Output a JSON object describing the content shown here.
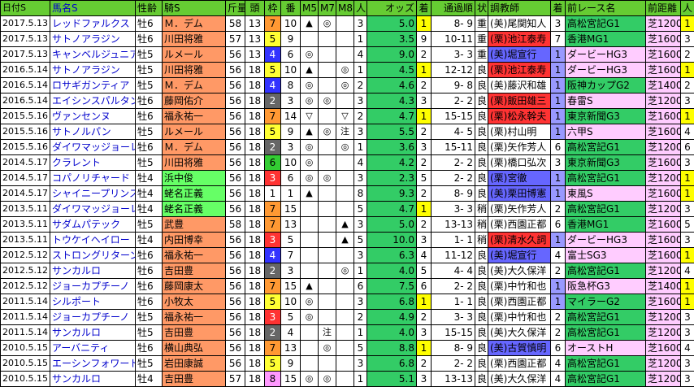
{
  "headers": [
    "日付S",
    "馬名S",
    "性齢",
    "騎S",
    "斤量",
    "頭",
    "枠",
    "番",
    "M5",
    "M7",
    "M8",
    "人",
    "オッズ",
    "着",
    "通過順",
    "状",
    "調教師",
    "着",
    "前レース名",
    "前距離",
    "人"
  ],
  "rows": [
    [
      "2017.5.13",
      "レッドファルクス",
      "牡6",
      "Ｍ．デム",
      "58",
      "13",
      "7",
      "10",
      "▲",
      "◎",
      "",
      "3",
      "5.0",
      "1",
      "8- 9",
      "重",
      "(美)尾関知人",
      "3",
      "高松宮記G1",
      "芝1200",
      "1"
    ],
    [
      "2017.5.13",
      "サトノアラジン",
      "牡6",
      "川田将雅",
      "57",
      "13",
      "5",
      "9",
      "",
      "",
      "",
      "1",
      "3.5",
      "9",
      "10-11",
      "重",
      "(栗)池江泰寿",
      "7",
      "香港MG1",
      "芝1600",
      "3"
    ],
    [
      "2017.5.13",
      "キャンベルジュニア",
      "牡5",
      "ルメール",
      "56",
      "13",
      "4",
      "6",
      "◎",
      "",
      "",
      "4",
      "9.0",
      "2",
      "3- 3",
      "重",
      "(美)堀宣行",
      "1",
      "ダービーHG3",
      "芝1600",
      "2"
    ],
    [
      "2016.5.14",
      "サトノアラジン",
      "牡5",
      "川田将雅",
      "56",
      "18",
      "5",
      "10",
      "▲",
      "",
      "◎",
      "1",
      "4.5",
      "1",
      "12-12",
      "良",
      "(栗)池江泰寿",
      "1",
      "ダービーHG3",
      "芝1600",
      "1"
    ],
    [
      "2016.5.14",
      "ロサギガンティア",
      "牡5",
      "Ｍ．デム",
      "56",
      "18",
      "4",
      "8",
      "◎",
      "",
      "◎",
      "2",
      "4.6",
      "2",
      "9- 8",
      "良",
      "(美)藤沢和雄",
      "1",
      "阪神カップG2",
      "芝1400",
      "2"
    ],
    [
      "2016.5.14",
      "エイシンスパルタン",
      "牡6",
      "藤岡佑介",
      "56",
      "18",
      "2",
      "3",
      "◎",
      "◎",
      "",
      "3",
      "4.3",
      "3",
      "2- 2",
      "良",
      "(栗)飯田雄三",
      "1",
      "春雷S",
      "芝1200",
      "3"
    ],
    [
      "2015.5.16",
      "ヴァンセンヌ",
      "牡6",
      "福永祐一",
      "56",
      "18",
      "7",
      "14",
      "▽",
      "",
      "▽",
      "2",
      "4.7",
      "1",
      "15-15",
      "良",
      "(栗)松永幹夫",
      "1",
      "東京新聞G3",
      "芝1600",
      "1"
    ],
    [
      "2015.5.16",
      "サトノルパン",
      "牡5",
      "ルメール",
      "56",
      "18",
      "5",
      "9",
      "▲",
      "◎",
      "注",
      "3",
      "5.5",
      "2",
      "4- 5",
      "良",
      "(栗)村山明",
      "1",
      "六甲S",
      "芝1600",
      "4"
    ],
    [
      "2015.5.16",
      "ダイワマッジョーレ",
      "牡6",
      "Ｍ．デム",
      "56",
      "18",
      "2",
      "3",
      "◎",
      "",
      "◎",
      "1",
      "3.6",
      "3",
      "15-11",
      "良",
      "(栗)矢作芳人",
      "6",
      "高松宮記G1",
      "芝1200",
      "6"
    ],
    [
      "2014.5.17",
      "クラレント",
      "牡5",
      "川田将雅",
      "56",
      "18",
      "6",
      "10",
      "◎",
      "",
      "",
      "4",
      "4.2",
      "2",
      "2- 2",
      "良",
      "(栗)橋口弘次",
      "3",
      "東京新聞G3",
      "芝1600",
      "3"
    ],
    [
      "2014.5.17",
      "コパノリチャード",
      "牡4",
      "浜中俊",
      "56",
      "18",
      "3",
      "6",
      "◎",
      "◎",
      "",
      "3",
      "2.3",
      "5",
      "2- 2",
      "良",
      "(栗)宮徹",
      "1",
      "高松宮記G1",
      "芝1200",
      "1"
    ],
    [
      "2014.5.17",
      "シャイニープリンス",
      "牡4",
      "蛯名正義",
      "56",
      "18",
      "1",
      "1",
      "▲",
      "",
      "",
      "8",
      "9.3",
      "2",
      "8- 9",
      "良",
      "(美)栗田博憲",
      "1",
      "東風S",
      "芝1600",
      "1"
    ],
    [
      "2013.5.11",
      "ダイワマッジョーレ",
      "牡4",
      "蛯名正義",
      "56",
      "18",
      "7",
      "15",
      "",
      "",
      "",
      "5",
      "4.7",
      "1",
      "3- 3",
      "稍",
      "(栗)矢作芳人",
      "2",
      "高松宮記G1",
      "芝1200",
      "3"
    ],
    [
      "2013.5.11",
      "サダムパテック",
      "牡5",
      "武豊",
      "58",
      "18",
      "7",
      "13",
      "",
      "",
      "▲",
      "3",
      "5.0",
      "2",
      "13-13",
      "稍",
      "(栗)西園正都",
      "6",
      "香港MG1",
      "芝1600",
      "5"
    ],
    [
      "2013.5.11",
      "トウケイヘイロー",
      "牡4",
      "内田博幸",
      "56",
      "18",
      "3",
      "5",
      "",
      "",
      "▲",
      "5",
      "10.0",
      "3",
      "1- 1",
      "稍",
      "(栗)清水久詞",
      "1",
      "ダービーHG3",
      "芝1600",
      "3"
    ],
    [
      "2012.5.12",
      "ストロングリターン",
      "牡6",
      "福永祐一",
      "56",
      "18",
      "4",
      "7",
      "",
      "",
      "",
      "3",
      "6.3",
      "4",
      "11-12",
      "良",
      "(美)堀宣行",
      "4",
      "富士SG3",
      "芝1600",
      "1"
    ],
    [
      "2012.5.12",
      "サンカルロ",
      "牡6",
      "吉田豊",
      "56",
      "18",
      "2",
      "3",
      "",
      "",
      "◎",
      "1",
      "4.0",
      "5",
      "4- 4",
      "良",
      "(美)大久保洋",
      "2",
      "高松宮記G1",
      "芝1200",
      "4"
    ],
    [
      "2012.5.12",
      "ジョーカプチーノ",
      "牡6",
      "藤岡康太",
      "56",
      "18",
      "7",
      "15",
      "▲",
      "",
      "",
      "6",
      "7.5",
      "6",
      "2- 2",
      "良",
      "(栗)中竹和也",
      "1",
      "阪急杯G3",
      "芝1400",
      "1"
    ],
    [
      "2011.5.14",
      "シルポート",
      "牡6",
      "小牧太",
      "56",
      "18",
      "5",
      "10",
      "◎",
      "",
      "",
      "3",
      "6.8",
      "1",
      "1- 1",
      "良",
      "(栗)西園正都",
      "1",
      "マイラーG2",
      "芝1600",
      "1"
    ],
    [
      "2011.5.14",
      "ジョーカプチーノ",
      "牡5",
      "福永祐一",
      "56",
      "18",
      "3",
      "5",
      "◎",
      "",
      "",
      "2",
      "4.9",
      "2",
      "3- 3",
      "良",
      "(栗)中竹和也",
      "2",
      "高松宮記G1",
      "芝1200",
      "3"
    ],
    [
      "2011.5.14",
      "サンカルロ",
      "牡5",
      "吉田豊",
      "56",
      "18",
      "2",
      "4",
      "",
      "注",
      "",
      "1",
      "4.0",
      "3",
      "15-15",
      "良",
      "(美)大久保洋",
      "2",
      "高松宮記G1",
      "芝1200",
      "3"
    ],
    [
      "2010.5.15",
      "アーバニティ",
      "牡6",
      "横山典弘",
      "56",
      "18",
      "7",
      "13",
      "",
      "◎",
      "",
      "5",
      "8.8",
      "1",
      "8- 9",
      "良",
      "(美)古賀慎明",
      "6",
      "オーストH",
      "芝1600",
      "4"
    ],
    [
      "2010.5.15",
      "エーシンフォワード",
      "牡5",
      "岩田康誠",
      "56",
      "18",
      "5",
      "9",
      "",
      "",
      "",
      "3",
      "6.8",
      "2",
      "2- 2",
      "良",
      "(栗)西園正都",
      "4",
      "高松宮記G1",
      "芝1200",
      "3"
    ],
    [
      "2010.5.15",
      "サンカルロ",
      "牡4",
      "吉田豊",
      "57",
      "18",
      "8",
      "15",
      "◎",
      "◎",
      "",
      "1",
      "5.1",
      "3",
      "13-13",
      "良",
      "(美)大久保洋",
      "4",
      "高松宮記G1",
      "芝1200",
      "3"
    ]
  ],
  "colors": {
    "header_bg": "#66cc33",
    "jockey_orange": "#ff9966",
    "jockey_green": "#66ff66",
    "waku": [
      "#ffffff",
      "#ffffff",
      "#666666",
      "#ff3333",
      "#3333ff",
      "#ffff33",
      "#33cc33",
      "#ff9933",
      "#ff99ff"
    ],
    "odds_green": "#33cc66",
    "finish_yellow": "#ffff00",
    "trainer_ritto": "#ff3333",
    "trainer_miho": "#ffffff",
    "trainer_blue": "#6666ff",
    "prevpos_purple": "#9999ff",
    "prevrace_green": "#33cc66",
    "prevrace_pink": "#ffccff",
    "prevdist": "#ffccff"
  }
}
